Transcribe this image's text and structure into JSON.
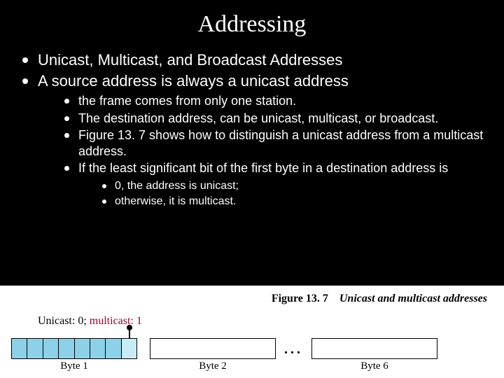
{
  "title": "Addressing",
  "bullets": {
    "l1_0": "Unicast, Multicast, and Broadcast Addresses",
    "l1_1": "A source address is always a unicast address",
    "l2_0": "the frame comes from only one station.",
    "l2_1": "The destination address, can be unicast, multicast, or broadcast.",
    "l2_2": "Figure 13. 7 shows how to distinguish a unicast address from a multicast address.",
    "l2_3": "If the least significant bit of the first byte in a destination address is",
    "l3_0": "0, the address is unicast;",
    "l3_1": "otherwise, it is multicast."
  },
  "figure": {
    "number": "Figure 13. 7",
    "title": "Unicast and multicast addresses",
    "key_unicast": "Unicast: 0; ",
    "key_multicast": "multicast: 1",
    "byte1": "Byte 1",
    "byte2": "Byte 2",
    "byte6": "Byte 6",
    "ellipsis": "..."
  }
}
